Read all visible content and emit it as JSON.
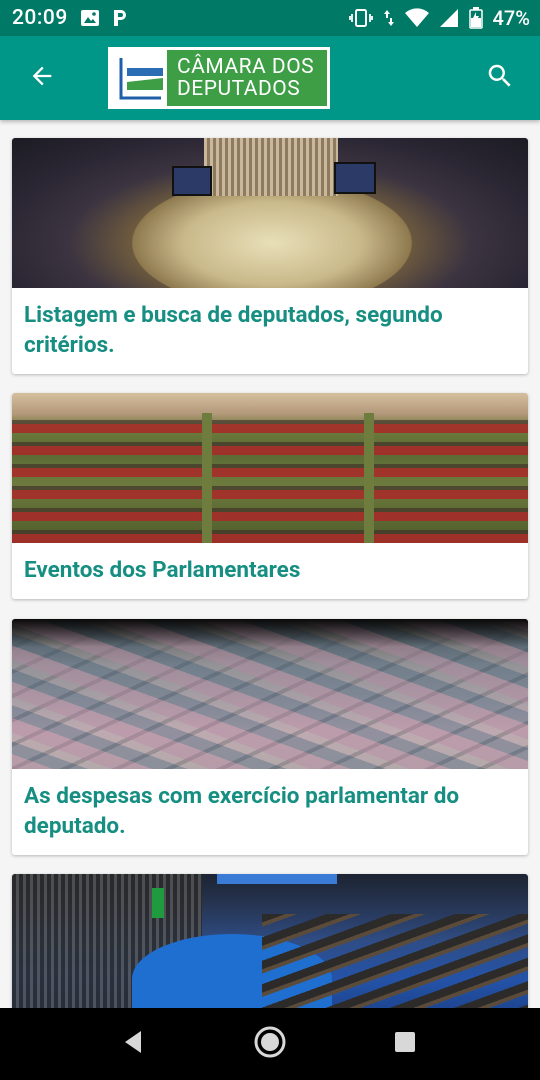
{
  "status_bar": {
    "time": "20:09",
    "battery_percent": "47%",
    "icons": [
      "image-icon",
      "parking-p-icon",
      "vibrate-icon",
      "data-arrows-icon",
      "wifi-icon",
      "signal-icon",
      "battery-icon"
    ]
  },
  "app_bar": {
    "logo_line1": "CÂMARA DOS",
    "logo_line2": "DEPUTADOS",
    "back_icon": "arrow-back-icon",
    "search_icon": "search-icon",
    "background_color": "#009688",
    "logo_color": "#3e9e46"
  },
  "cards": [
    {
      "title": "Listagem e busca de deputados, segundo critérios.",
      "image": "plenary-hall-photo"
    },
    {
      "title": "Eventos dos Parlamentares",
      "image": "event-audience-photo"
    },
    {
      "title": "As despesas com exercício parlamentar do deputado.",
      "image": "money-bills-photo"
    },
    {
      "title": "",
      "image": "senate-chamber-photo"
    }
  ],
  "theme": {
    "title_color": "#168f82",
    "status_bar_color": "#007a66"
  },
  "nav_bar": {
    "icons": [
      "back-triangle-icon",
      "home-circle-icon",
      "recents-square-icon"
    ]
  }
}
